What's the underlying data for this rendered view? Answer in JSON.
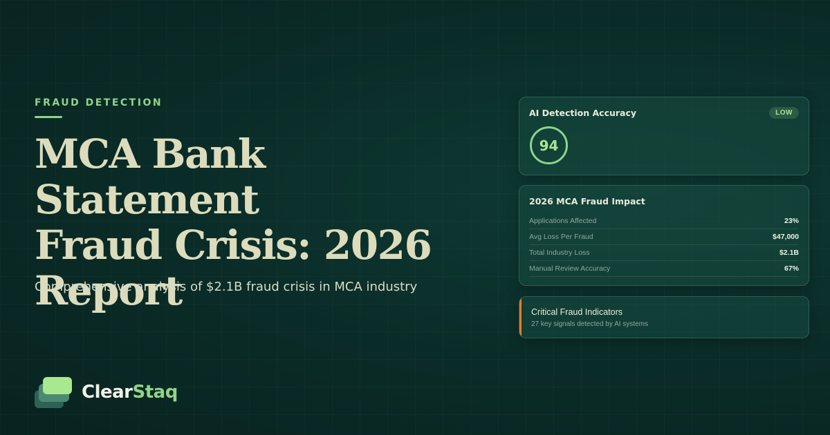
{
  "hero": {
    "eyebrow": "FRAUD DETECTION",
    "title_lines": [
      "MCA Bank Statement",
      "Fraud Crisis: 2026",
      "Report"
    ],
    "subtitle": "Comprehensive analysis of $2.1B fraud crisis in MCA industry"
  },
  "brand": {
    "name_part1": "Clear",
    "name_part2": "Staq"
  },
  "accuracy_card": {
    "title": "AI Detection Accuracy",
    "badge": "LOW",
    "score": "94"
  },
  "impact_card": {
    "title": "2026 MCA Fraud Impact",
    "rows": [
      {
        "label": "Applications Affected",
        "value": "23%"
      },
      {
        "label": "Avg Loss Per Fraud",
        "value": "$47,000"
      },
      {
        "label": "Total Industry Loss",
        "value": "$2.1B"
      },
      {
        "label": "Manual Review Accuracy",
        "value": "67%"
      }
    ]
  },
  "indicators_card": {
    "title": "Critical Fraud Indicators",
    "subtitle": "27 key signals detected by AI systems"
  },
  "colors": {
    "background": "#0a2b27",
    "accent_green": "#8fd489",
    "title_cream": "#dcdcbc",
    "warning_orange": "#f07a24"
  }
}
